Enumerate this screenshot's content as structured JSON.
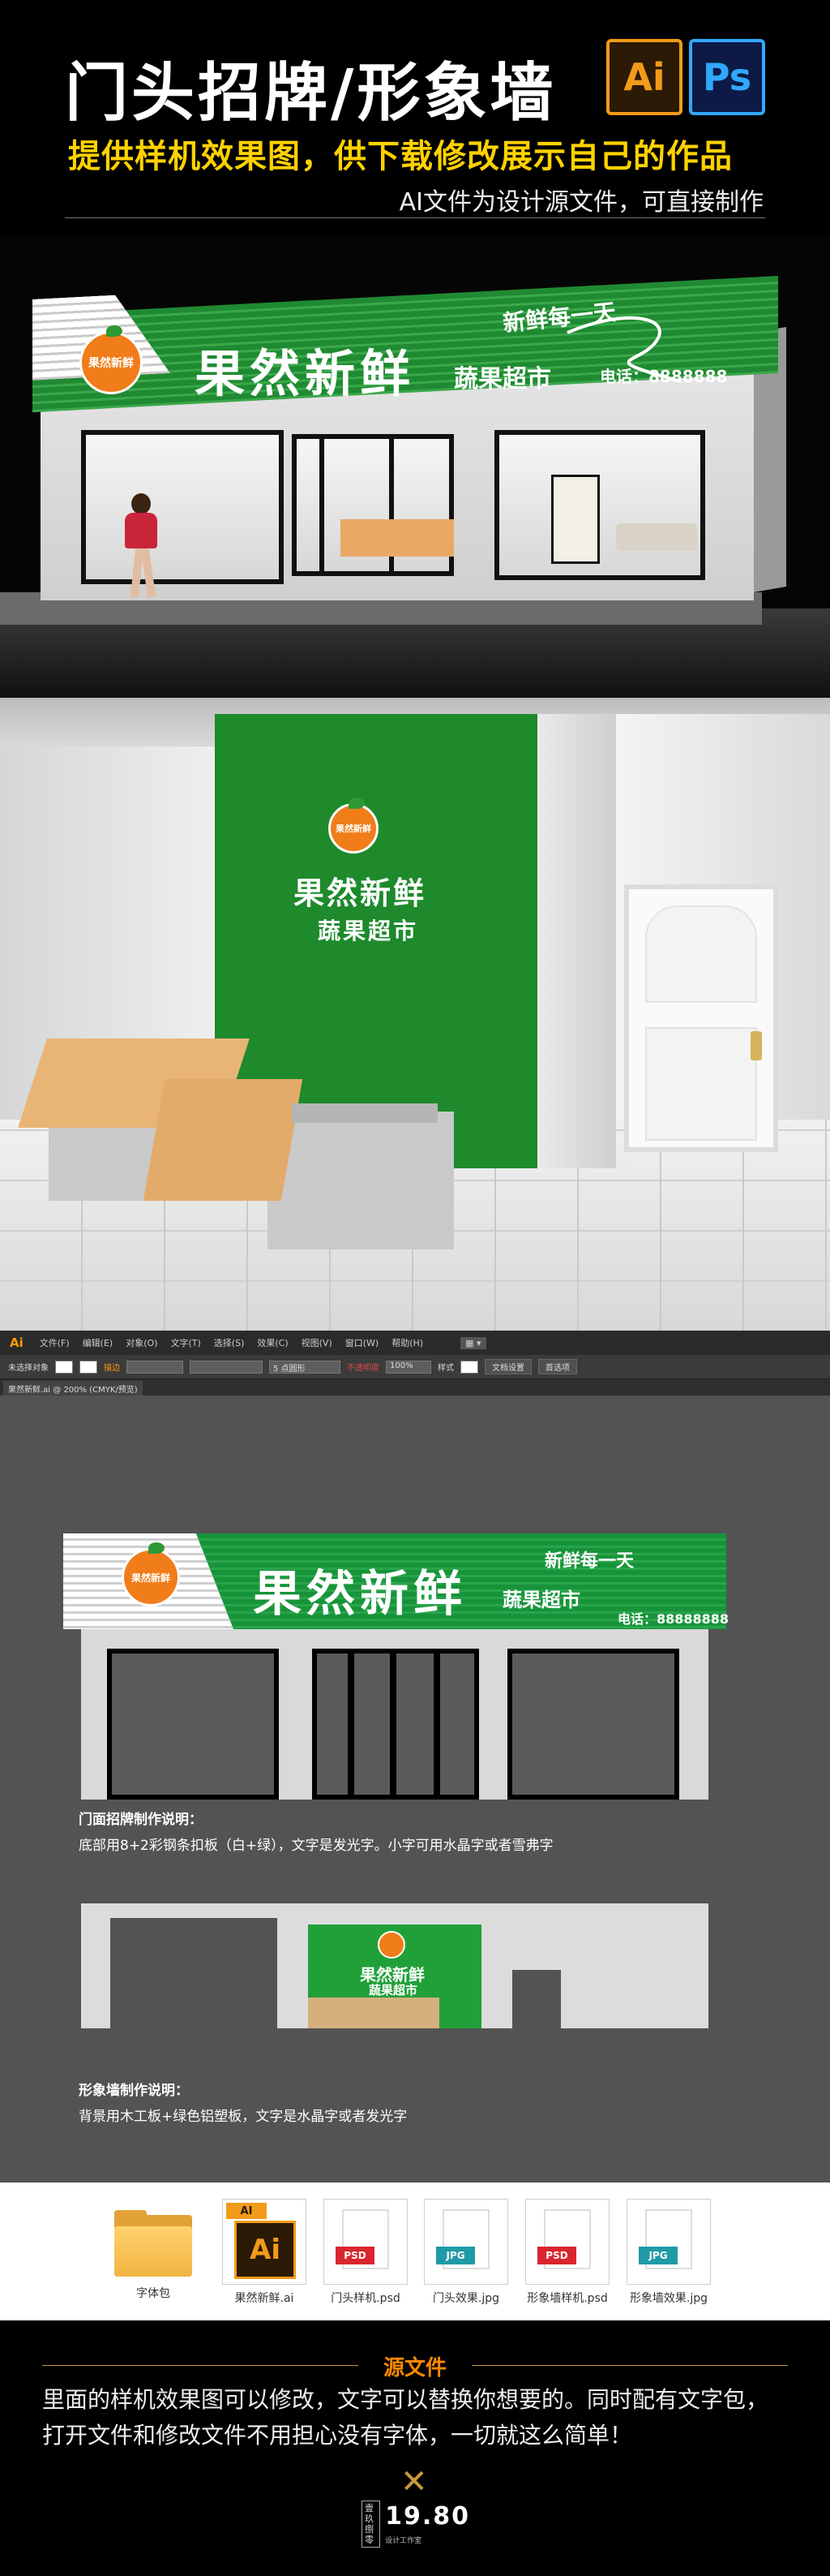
{
  "header": {
    "title": "门头招牌/形象墙",
    "subtitle": "提供样机效果图，供下载修改展示自己的作品",
    "note": "AI文件为设计源文件，可直接制作",
    "icons": [
      {
        "label": "Ai",
        "icon": "illustrator-icon",
        "color": "#f29b1a"
      },
      {
        "label": "Ps",
        "icon": "photoshop-icon",
        "color": "#31a8ff"
      }
    ]
  },
  "sign": {
    "logo_text": "果然新鲜",
    "brand": "果然新鲜",
    "category": "蔬果超市",
    "slogan": "新鲜每一天",
    "phone_store": "电话：8888888",
    "phone_flat": "电话：88888888",
    "green": "#1f8a32",
    "orange": "#f07d1a"
  },
  "illustrator": {
    "menu": [
      "文件(F)",
      "编辑(E)",
      "对象(O)",
      "文字(T)",
      "选择(S)",
      "效果(C)",
      "视图(V)",
      "窗口(W)",
      "帮助(H)"
    ],
    "controls": {
      "selection": "未选择对象",
      "stroke_label": "描边",
      "size_value": "5 点圆形",
      "opacity_label": "不透明度",
      "opacity_value": "100%",
      "style_label": "样式",
      "doc_settings": "文档设置",
      "preferences": "首选项"
    },
    "tab": "果然新鲜.ai @ 200% (CMYK/预览)",
    "caption1_title": "门面招牌制作说明：",
    "caption1_text": "底部用8+2彩钢条扣板（白+绿），文字是发光字。小字可用水晶字或者雪弗字",
    "caption2_title": "形象墙制作说明：",
    "caption2_text": "背景用木工板+绿色铝塑板，文字是水晶字或者发光字"
  },
  "files": [
    {
      "label": "字体包",
      "icon": "folder-icon"
    },
    {
      "label": "果然新鲜.ai",
      "icon": "ai-file-icon",
      "tag": "AI"
    },
    {
      "label": "门头样机.psd",
      "icon": "psd-file-icon",
      "tag": "PSD"
    },
    {
      "label": "门头效果.jpg",
      "icon": "jpg-file-icon",
      "tag": "JPG"
    },
    {
      "label": "形象墙样机.psd",
      "icon": "psd-file-icon",
      "tag": "PSD"
    },
    {
      "label": "形象墙效果.jpg",
      "icon": "jpg-file-icon",
      "tag": "JPG"
    }
  ],
  "footer": {
    "title": "源文件",
    "line1": "里面的样机效果图可以修改，文字可以替换你想要的。同时配有文字包，",
    "line2": "打开文件和修改文件不用担心没有字体，一切就这么简单！",
    "brand_left": "壹玖捌零",
    "brand_num": "19.80",
    "brand_sub": "设计工作室"
  }
}
